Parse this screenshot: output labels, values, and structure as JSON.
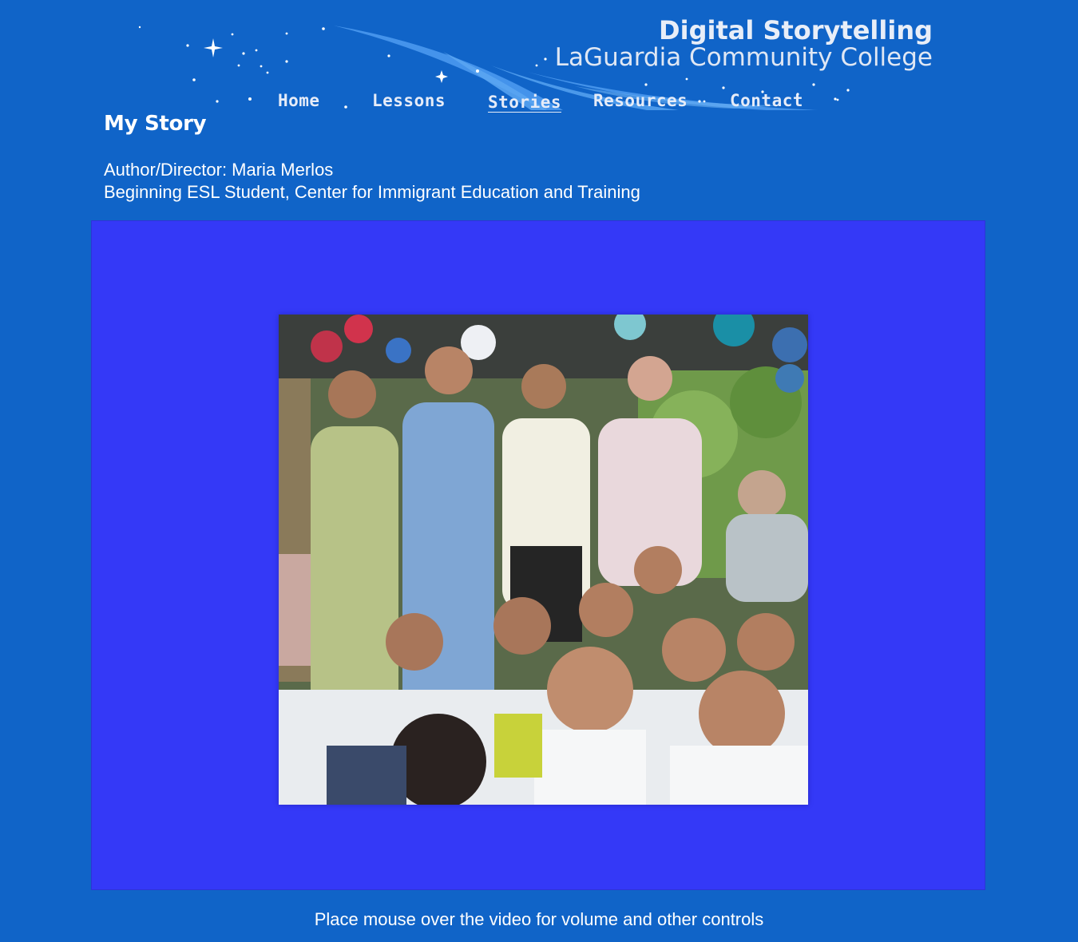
{
  "header": {
    "title_line1": "Digital Storytelling",
    "title_line2": "LaGuardia Community College"
  },
  "nav": {
    "items": [
      {
        "label": "Home"
      },
      {
        "label": "Lessons"
      },
      {
        "label": "Stories",
        "active": true
      },
      {
        "label": "Resources"
      },
      {
        "label": "Contact"
      }
    ]
  },
  "story": {
    "title": "My Story",
    "author": "Author/Director: Maria Merlos",
    "affiliation": "Beginning ESL Student, Center for Immigrant Education and Training"
  },
  "video": {
    "frame_color": "#3439f7",
    "caption": "Place mouse over the video for volume and other controls"
  },
  "colors": {
    "page_background": "#1064c8",
    "text": "#ffffff"
  }
}
